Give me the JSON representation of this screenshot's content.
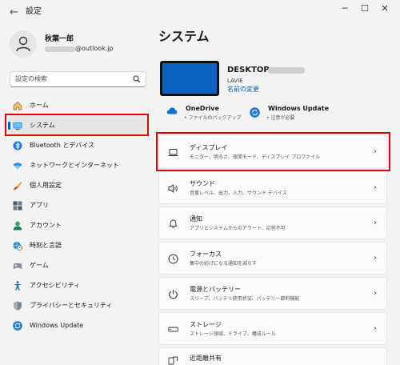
{
  "window": {
    "title": "設定",
    "icon": "back-arrow-icon",
    "controls": [
      "minimize-icon",
      "maximize-icon",
      "close-icon"
    ]
  },
  "user": {
    "name": "秋葉一郎",
    "email_domain": "@outlook.jp"
  },
  "search": {
    "placeholder": "設定の検索"
  },
  "nav": {
    "items": [
      {
        "label": "ホーム",
        "icon": "home-icon"
      },
      {
        "label": "システム",
        "icon": "monitor-icon",
        "selected": true
      },
      {
        "label": "Bluetooth とデバイス",
        "icon": "bluetooth-icon"
      },
      {
        "label": "ネットワークとインターネット",
        "icon": "wifi-icon"
      },
      {
        "label": "個人用設定",
        "icon": "brush-icon"
      },
      {
        "label": "アプリ",
        "icon": "apps-icon"
      },
      {
        "label": "アカウント",
        "icon": "person-icon"
      },
      {
        "label": "時刻と言語",
        "icon": "globe-clock-icon"
      },
      {
        "label": "ゲーム",
        "icon": "gamepad-icon"
      },
      {
        "label": "アクセシビリティ",
        "icon": "accessibility-icon"
      },
      {
        "label": "プライバシーとセキュリティ",
        "icon": "shield-icon"
      },
      {
        "label": "Windows Update",
        "icon": "sync-icon"
      }
    ]
  },
  "main": {
    "title": "システム",
    "device": {
      "name": "DESKTOP-",
      "model": "LAVIE",
      "rename": "名前の変更"
    },
    "status": [
      {
        "title": "OneDrive",
        "sub": "ファイルのバックアップ",
        "icon": "cloud-icon"
      },
      {
        "title": "Windows Update",
        "sub": "注意が必要",
        "icon": "sync-icon"
      }
    ],
    "cards": [
      {
        "title": "ディスプレイ",
        "desc": "モニター、明るさ、夜間モード、ディスプレイ プロファイル",
        "icon": "laptop-icon",
        "highlighted": true
      },
      {
        "title": "サウンド",
        "desc": "音量レベル、出力、入力、サウンド デバイス",
        "icon": "speaker-icon"
      },
      {
        "title": "通知",
        "desc": "アプリとシステムからのアラート、応答不可",
        "icon": "bell-icon"
      },
      {
        "title": "フォーカス",
        "desc": "集中の妨げになる通知を減らす",
        "icon": "focus-icon"
      },
      {
        "title": "電源とバッテリー",
        "desc": "スリープ、バッテリ使用状況、バッテリー節約機能",
        "icon": "power-icon"
      },
      {
        "title": "ストレージ",
        "desc": "ストレージ領域、ドライブ、構成ルール",
        "icon": "storage-icon"
      },
      {
        "title": "近距離共有",
        "desc": "",
        "icon": "share-icon"
      }
    ],
    "chevron": "›"
  },
  "colors": {
    "accent": "#005fb8",
    "highlight": "#e00000",
    "background": "#f3f3f3",
    "card": "#fbfbfb"
  }
}
